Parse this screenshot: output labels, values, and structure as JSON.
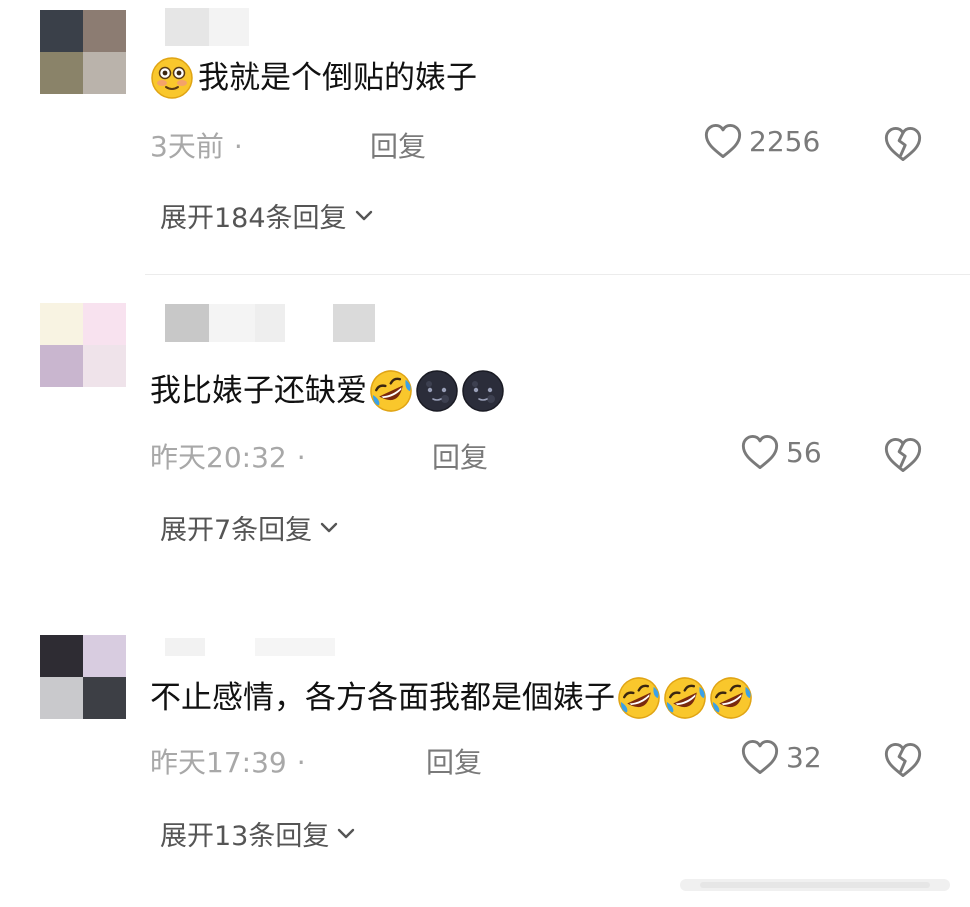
{
  "comments": [
    {
      "text": "我就是个倒贴的婊子",
      "time": "3天前",
      "reply_label": "回复",
      "likes": "2256",
      "expand_label": "展开184条回复",
      "emojis": [
        "flushed-emoji"
      ]
    },
    {
      "text": "我比婊子还缺爱",
      "time": "昨天20:32",
      "reply_label": "回复",
      "likes": "56",
      "expand_label": "展开7条回复",
      "emojis": [
        "rofl-emoji",
        "dark-moon-face-emoji",
        "dark-moon-face-emoji"
      ]
    },
    {
      "text": "不止感情，各方各面我都是個婊子",
      "time": "昨天17:39",
      "reply_label": "回复",
      "likes": "32",
      "expand_label": "展开13条回复",
      "emojis": [
        "rofl-emoji",
        "rofl-emoji",
        "rofl-emoji"
      ]
    }
  ],
  "icons": {
    "like": "heart-outline-icon",
    "dislike": "broken-heart-icon",
    "expand": "chevron-down-icon"
  },
  "colors": {
    "meta_text": "#a8a8a8",
    "action_text": "#7a7a7a",
    "expand_text": "#555555"
  }
}
